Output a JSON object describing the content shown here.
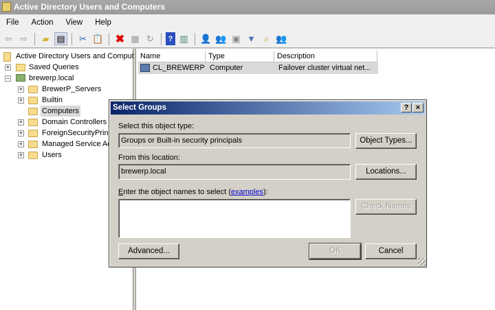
{
  "window": {
    "title": "Active Directory Users and Computers"
  },
  "menu": [
    "File",
    "Action",
    "View",
    "Help"
  ],
  "toolbar": [
    "back-icon",
    "forward-icon",
    "up-folder-icon",
    "show-hide-tree-icon",
    "cut-icon",
    "paste-icon",
    "delete-icon",
    "properties-icon",
    "refresh-icon",
    "help-icon",
    "action-pane-icon",
    "new-user-icon",
    "new-group-icon",
    "new-ou-icon",
    "filter-icon",
    "find-icon",
    "add-to-group-icon"
  ],
  "tree": {
    "root": "Active Directory Users and Comput",
    "saved_queries": "Saved Queries",
    "domain": "brewerp.local",
    "children": [
      "BrewerP_Servers",
      "Builtin",
      "Computers",
      "Domain Controllers",
      "ForeignSecurityPrinc",
      "Managed Service Ac",
      "Users"
    ]
  },
  "list": {
    "headers": [
      "Name",
      "Type",
      "Description"
    ],
    "rows": [
      {
        "name": "CL_BREWERP",
        "type": "Computer",
        "description": "Failover cluster virtual net..."
      }
    ]
  },
  "dialog": {
    "title": "Select Groups",
    "help": "?",
    "close": "×",
    "object_type_label": "Select this object type:",
    "object_type_value": "Groups or Built-in security principals",
    "object_types_button": "Object Types...",
    "location_label": "From this location:",
    "location_value": "brewerp.local",
    "locations_button": "Locations...",
    "names_label_first": "E",
    "names_label_rest": "nter the object names to select (",
    "examples_link": "examples",
    "names_label_end": "):",
    "names_value": "",
    "check_names_button": "Check Names",
    "advanced_button": "Advanced...",
    "ok_button": "OK",
    "cancel_button": "Cancel"
  }
}
